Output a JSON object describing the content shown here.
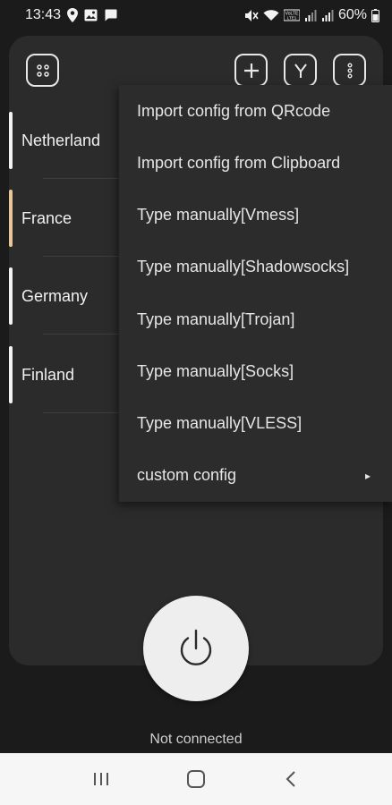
{
  "status_bar": {
    "time": "13:43",
    "battery_text": "60%",
    "left_icons": [
      "location-pin-icon",
      "image-icon",
      "message-icon"
    ],
    "right_icons": [
      "mute-icon",
      "wifi-icon",
      "volte-icon",
      "signal-icon",
      "signal-icon-2",
      "battery-icon"
    ]
  },
  "toolbar": {
    "left_icon": "grid-dots-icon",
    "add_icon": "plus-icon",
    "filter_icon": "y-filter-icon",
    "more_icon": "more-vertical-icon"
  },
  "servers": [
    {
      "label": "Netherland",
      "bar_color": "#f2f2f2"
    },
    {
      "label": "France",
      "bar_color": "#e7c79a"
    },
    {
      "label": "Germany",
      "bar_color": "#f2f2f2"
    },
    {
      "label": "Finland",
      "bar_color": "#f2f2f2"
    }
  ],
  "menu": {
    "items": [
      "Import config from QRcode",
      "Import config from Clipboard",
      "Type manually[Vmess]",
      "Type manually[Shadowsocks]",
      "Type manually[Trojan]",
      "Type manually[Socks]",
      "Type manually[VLESS]",
      "custom config"
    ],
    "submenu_arrow": "▸"
  },
  "connection": {
    "status_text": "Not connected",
    "power_icon": "power-icon"
  },
  "nav_bar": {
    "recents_icon": "recents-icon",
    "home_icon": "home-icon",
    "back_icon": "back-icon"
  },
  "colors": {
    "background": "#1b1b1b",
    "card": "#2b2b2b",
    "menu": "#2c2c2c",
    "accent": "#e7c79a"
  }
}
